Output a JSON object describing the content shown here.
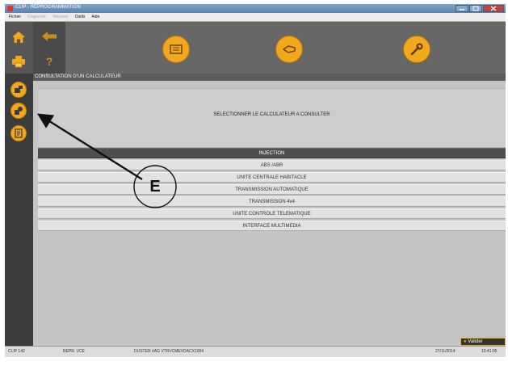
{
  "window": {
    "title": "CLIP - REPROGRAMMATION"
  },
  "menu": [
    {
      "label": "Fichier",
      "enabled": true
    },
    {
      "label": "Diagnostic",
      "enabled": false
    },
    {
      "label": "Mesures",
      "enabled": false
    },
    {
      "label": "Outils",
      "enabled": true
    },
    {
      "label": "Aide",
      "enabled": true
    }
  ],
  "toolbar": {
    "help_label": "?",
    "buttons": [
      {
        "name": "ecu",
        "icon": "ecu-module-icon"
      },
      {
        "name": "comm",
        "icon": "communication-icon"
      },
      {
        "name": "tools",
        "icon": "wrench-icon"
      }
    ]
  },
  "sidebar": {
    "items": [
      {
        "name": "home",
        "icon": "home-icon"
      },
      {
        "name": "print",
        "icon": "printer-icon"
      },
      {
        "name": "consult",
        "icon": "ecu-consult-icon"
      },
      {
        "name": "identify",
        "icon": "ecu-identify-icon"
      },
      {
        "name": "report",
        "icon": "report-icon"
      }
    ]
  },
  "content": {
    "section_title": "CONSULTATION D'UN CALCULATEUR",
    "instruction": "SELECTIONNER LE CALCULATEUR A CONSULTER",
    "ecu_list": [
      {
        "label": "INJECTION",
        "selected": true
      },
      {
        "label": "ABS /ABR",
        "selected": false
      },
      {
        "label": "UNITE CENTRALE HABITACLE",
        "selected": false
      },
      {
        "label": "TRANSMISSION AUTOMATIQUE",
        "selected": false
      },
      {
        "label": "TRANSMISSION 4x4",
        "selected": false
      },
      {
        "label": "UNITE CONTROLE TELEMATIQUE",
        "selected": false
      },
      {
        "label": "INTERFACE MULTIMEDIA",
        "selected": false
      }
    ],
    "validate_label": "Valider"
  },
  "status": {
    "version": "CLIP 142",
    "repo": "REPR. VCE",
    "vin": "DUSTER #AG VTRVCMEVDACX1004",
    "date": "27/11/2014",
    "time": "10:41:05"
  },
  "annotation": {
    "label": "E"
  },
  "colors": {
    "accent": "#f2a81c",
    "sidebar": "#3c3c3c",
    "toolbar": "#676767",
    "selected_row": "#4f4f4f"
  }
}
